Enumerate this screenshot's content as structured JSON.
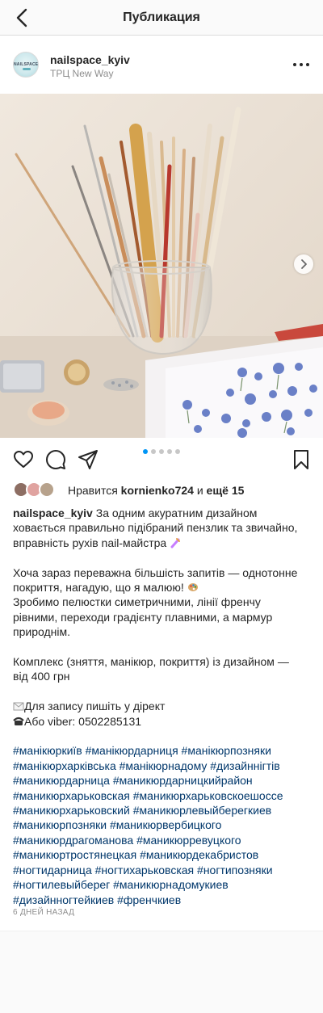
{
  "topbar": {
    "title": "Публикация",
    "back_icon": "chevron-left-icon"
  },
  "post": {
    "username": "nailspace_kyiv",
    "location": "ТРЦ New Way",
    "avatar_logo_text": "NAILSPACE",
    "more_icon": "more-horizontal-icon",
    "carousel": {
      "total": 5,
      "current": 1,
      "next_icon": "chevron-right-icon"
    },
    "actions": [
      "heart-icon",
      "comment-icon",
      "share-icon",
      "bookmark-icon"
    ],
    "likes": {
      "prefix": "Нравится",
      "user": "kornienko724",
      "middle": "и",
      "others": "ещё 15"
    },
    "caption": {
      "lines": [
        "За одним акуратним дизайном",
        "ховається правильно підібраний пензлик та звичайно,",
        "вправність рухів nail-майстра",
        "",
        "Хоча зараз переважна більшість запитів — однотонне",
        "покриття, нагадую, що я малюю!",
        "Зробимо пелюстки симетричними, лінії френчу",
        "рівними, переходи градієнту плавними, а мармур",
        "природнім.",
        "",
        "Комплекс (зняття, манікюр, покриття) із дизайном —",
        "від 400 грн",
        "",
        "Для запису пишіть у дірект",
        "Або viber: 0502285131",
        ""
      ],
      "hashtags": [
        "#манікюркиїв #манікюрдарниця #манікюрпозняки",
        "#манікюрхарківська #манікюрнадому #дизайннігтів",
        "#маникюрдарница #маникюрдарницкийрайон",
        "#маникюрхарьковская #маникюрхарьковскоешоссе",
        "#маникюрхарьковский #маникюрлевыйберегкиев",
        "#маникюрпозняки #маникюрвербицкого",
        "#маникюрдрагоманова #маникюрревуцкого",
        "#маникюртростянецкая #маникюрдекабристов",
        "#ногтидарница #ногтихарьковская #ногтипозняки",
        "#ногтилевыйберег #маникюрнадомукиев",
        "#дизайнногтейкиев #френчкиев"
      ]
    },
    "time_ago": "6 ДНЕЙ НАЗАД"
  },
  "colors": {
    "link": "#00376b",
    "muted": "#8e8e8e",
    "accent_dot": "#0095f6",
    "text": "#262626"
  }
}
